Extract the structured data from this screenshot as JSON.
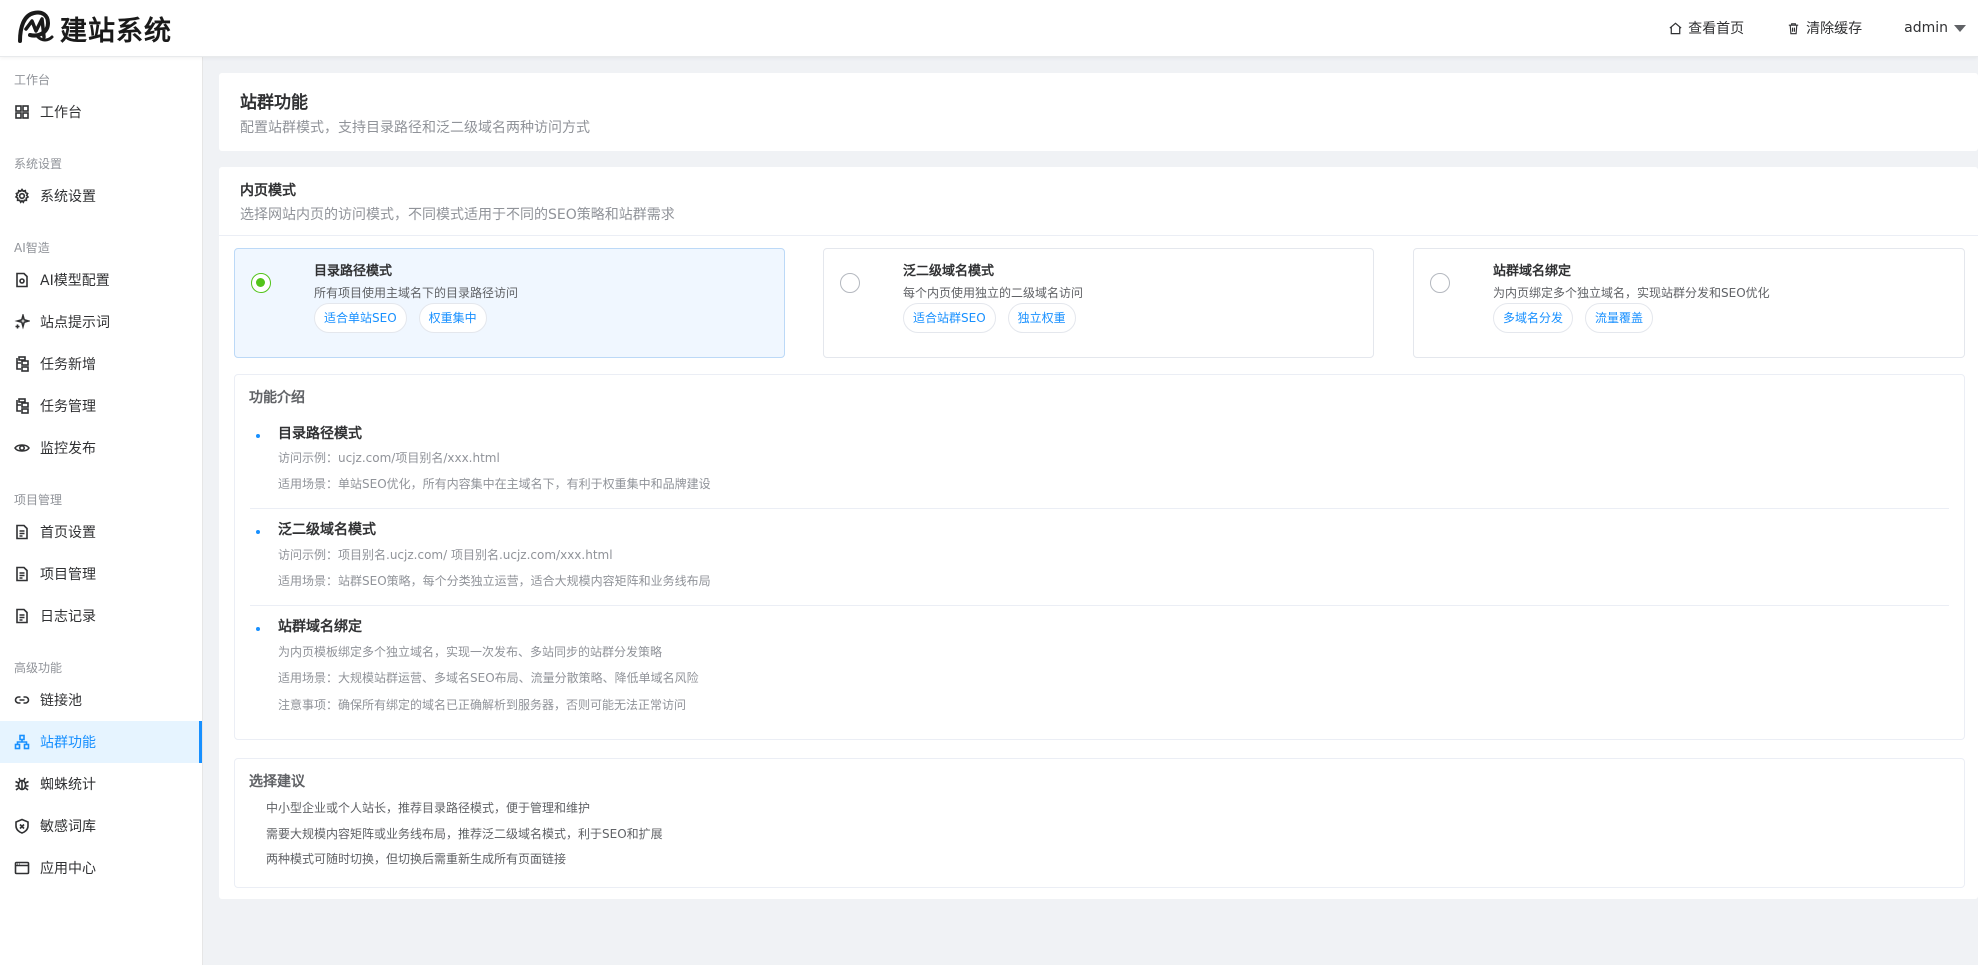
{
  "brand": {
    "name": "建站系统"
  },
  "header": {
    "view_home": "查看首页",
    "clear_cache": "清除缓存",
    "user": "admin"
  },
  "sidebar": {
    "groups": [
      {
        "label": "工作台",
        "items": [
          {
            "label": "工作台",
            "icon": "dashboard-icon"
          }
        ]
      },
      {
        "label": "系统设置",
        "items": [
          {
            "label": "系统设置",
            "icon": "gear-icon"
          }
        ]
      },
      {
        "label": "AI智造",
        "items": [
          {
            "label": "AI模型配置",
            "icon": "document-icon"
          },
          {
            "label": "站点提示词",
            "icon": "sparkle-icon"
          },
          {
            "label": "任务新增",
            "icon": "tree-icon"
          },
          {
            "label": "任务管理",
            "icon": "tree-icon"
          },
          {
            "label": "监控发布",
            "icon": "eye-icon"
          }
        ]
      },
      {
        "label": "项目管理",
        "items": [
          {
            "label": "首页设置",
            "icon": "file-icon"
          },
          {
            "label": "项目管理",
            "icon": "file-icon"
          },
          {
            "label": "日志记录",
            "icon": "file-icon"
          }
        ]
      },
      {
        "label": "高级功能",
        "items": [
          {
            "label": "链接池",
            "icon": "link-icon"
          },
          {
            "label": "站群功能",
            "icon": "cluster-icon",
            "active": true
          },
          {
            "label": "蜘蛛统计",
            "icon": "bug-icon"
          },
          {
            "label": "敏感词库",
            "icon": "shield-icon"
          },
          {
            "label": "应用中心",
            "icon": "window-icon"
          }
        ]
      }
    ]
  },
  "page": {
    "title": "站群功能",
    "subtitle": "配置站群模式，支持目录路径和泛二级域名两种访问方式"
  },
  "inner_mode": {
    "title": "内页模式",
    "subtitle": "选择网站内页的访问模式，不同模式适用于不同的SEO策略和站群需求",
    "options": [
      {
        "title": "目录路径模式",
        "desc": "所有项目使用主域名下的目录路径访问",
        "tags": [
          "适合单站SEO",
          "权重集中"
        ],
        "selected": true
      },
      {
        "title": "泛二级域名模式",
        "desc": "每个内页使用独立的二级域名访问",
        "tags": [
          "适合站群SEO",
          "独立权重"
        ],
        "selected": false
      },
      {
        "title": "站群域名绑定",
        "desc": "为内页绑定多个独立域名，实现站群分发和SEO优化",
        "tags": [
          "多域名分发",
          "流量覆盖"
        ],
        "selected": false
      }
    ]
  },
  "intro": {
    "title": "功能介绍",
    "items": [
      {
        "title": "目录路径模式",
        "lines": [
          "访问示例：ucjz.com/项目别名/xxx.html",
          "适用场景：单站SEO优化，所有内容集中在主域名下，有利于权重集中和品牌建设"
        ]
      },
      {
        "title": "泛二级域名模式",
        "lines": [
          "访问示例：项目别名.ucjz.com/ 项目别名.ucjz.com/xxx.html",
          "适用场景：站群SEO策略，每个分类独立运营，适合大规模内容矩阵和业务线布局"
        ]
      },
      {
        "title": "站群域名绑定",
        "lines": [
          "为内页模板绑定多个独立域名，实现一次发布、多站同步的站群分发策略",
          "适用场景：大规模站群运营、多域名SEO布局、流量分散策略、降低单域名风险",
          "注意事项：确保所有绑定的域名已正确解析到服务器，否则可能无法正常访问"
        ]
      }
    ]
  },
  "advice": {
    "title": "选择建议",
    "lines": [
      "中小型企业或个人站长，推荐目录路径模式，便于管理和维护",
      "需要大规模内容矩阵或业务线布局，推荐泛二级域名模式，利于SEO和扩展",
      "两种模式可随时切换，但切换后需重新生成所有页面链接"
    ]
  }
}
